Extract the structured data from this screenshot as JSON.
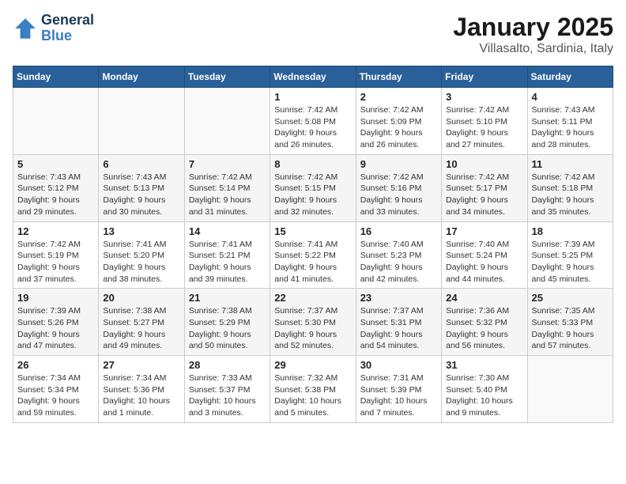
{
  "header": {
    "logo_line1": "General",
    "logo_line2": "Blue",
    "month": "January 2025",
    "location": "Villasalto, Sardinia, Italy"
  },
  "days_of_week": [
    "Sunday",
    "Monday",
    "Tuesday",
    "Wednesday",
    "Thursday",
    "Friday",
    "Saturday"
  ],
  "weeks": [
    [
      {
        "day": "",
        "info": ""
      },
      {
        "day": "",
        "info": ""
      },
      {
        "day": "",
        "info": ""
      },
      {
        "day": "1",
        "info": "Sunrise: 7:42 AM\nSunset: 5:08 PM\nDaylight: 9 hours and 26 minutes."
      },
      {
        "day": "2",
        "info": "Sunrise: 7:42 AM\nSunset: 5:09 PM\nDaylight: 9 hours and 26 minutes."
      },
      {
        "day": "3",
        "info": "Sunrise: 7:42 AM\nSunset: 5:10 PM\nDaylight: 9 hours and 27 minutes."
      },
      {
        "day": "4",
        "info": "Sunrise: 7:43 AM\nSunset: 5:11 PM\nDaylight: 9 hours and 28 minutes."
      }
    ],
    [
      {
        "day": "5",
        "info": "Sunrise: 7:43 AM\nSunset: 5:12 PM\nDaylight: 9 hours and 29 minutes."
      },
      {
        "day": "6",
        "info": "Sunrise: 7:43 AM\nSunset: 5:13 PM\nDaylight: 9 hours and 30 minutes."
      },
      {
        "day": "7",
        "info": "Sunrise: 7:42 AM\nSunset: 5:14 PM\nDaylight: 9 hours and 31 minutes."
      },
      {
        "day": "8",
        "info": "Sunrise: 7:42 AM\nSunset: 5:15 PM\nDaylight: 9 hours and 32 minutes."
      },
      {
        "day": "9",
        "info": "Sunrise: 7:42 AM\nSunset: 5:16 PM\nDaylight: 9 hours and 33 minutes."
      },
      {
        "day": "10",
        "info": "Sunrise: 7:42 AM\nSunset: 5:17 PM\nDaylight: 9 hours and 34 minutes."
      },
      {
        "day": "11",
        "info": "Sunrise: 7:42 AM\nSunset: 5:18 PM\nDaylight: 9 hours and 35 minutes."
      }
    ],
    [
      {
        "day": "12",
        "info": "Sunrise: 7:42 AM\nSunset: 5:19 PM\nDaylight: 9 hours and 37 minutes."
      },
      {
        "day": "13",
        "info": "Sunrise: 7:41 AM\nSunset: 5:20 PM\nDaylight: 9 hours and 38 minutes."
      },
      {
        "day": "14",
        "info": "Sunrise: 7:41 AM\nSunset: 5:21 PM\nDaylight: 9 hours and 39 minutes."
      },
      {
        "day": "15",
        "info": "Sunrise: 7:41 AM\nSunset: 5:22 PM\nDaylight: 9 hours and 41 minutes."
      },
      {
        "day": "16",
        "info": "Sunrise: 7:40 AM\nSunset: 5:23 PM\nDaylight: 9 hours and 42 minutes."
      },
      {
        "day": "17",
        "info": "Sunrise: 7:40 AM\nSunset: 5:24 PM\nDaylight: 9 hours and 44 minutes."
      },
      {
        "day": "18",
        "info": "Sunrise: 7:39 AM\nSunset: 5:25 PM\nDaylight: 9 hours and 45 minutes."
      }
    ],
    [
      {
        "day": "19",
        "info": "Sunrise: 7:39 AM\nSunset: 5:26 PM\nDaylight: 9 hours and 47 minutes."
      },
      {
        "day": "20",
        "info": "Sunrise: 7:38 AM\nSunset: 5:27 PM\nDaylight: 9 hours and 49 minutes."
      },
      {
        "day": "21",
        "info": "Sunrise: 7:38 AM\nSunset: 5:29 PM\nDaylight: 9 hours and 50 minutes."
      },
      {
        "day": "22",
        "info": "Sunrise: 7:37 AM\nSunset: 5:30 PM\nDaylight: 9 hours and 52 minutes."
      },
      {
        "day": "23",
        "info": "Sunrise: 7:37 AM\nSunset: 5:31 PM\nDaylight: 9 hours and 54 minutes."
      },
      {
        "day": "24",
        "info": "Sunrise: 7:36 AM\nSunset: 5:32 PM\nDaylight: 9 hours and 56 minutes."
      },
      {
        "day": "25",
        "info": "Sunrise: 7:35 AM\nSunset: 5:33 PM\nDaylight: 9 hours and 57 minutes."
      }
    ],
    [
      {
        "day": "26",
        "info": "Sunrise: 7:34 AM\nSunset: 5:34 PM\nDaylight: 9 hours and 59 minutes."
      },
      {
        "day": "27",
        "info": "Sunrise: 7:34 AM\nSunset: 5:36 PM\nDaylight: 10 hours and 1 minute."
      },
      {
        "day": "28",
        "info": "Sunrise: 7:33 AM\nSunset: 5:37 PM\nDaylight: 10 hours and 3 minutes."
      },
      {
        "day": "29",
        "info": "Sunrise: 7:32 AM\nSunset: 5:38 PM\nDaylight: 10 hours and 5 minutes."
      },
      {
        "day": "30",
        "info": "Sunrise: 7:31 AM\nSunset: 5:39 PM\nDaylight: 10 hours and 7 minutes."
      },
      {
        "day": "31",
        "info": "Sunrise: 7:30 AM\nSunset: 5:40 PM\nDaylight: 10 hours and 9 minutes."
      },
      {
        "day": "",
        "info": ""
      }
    ]
  ]
}
